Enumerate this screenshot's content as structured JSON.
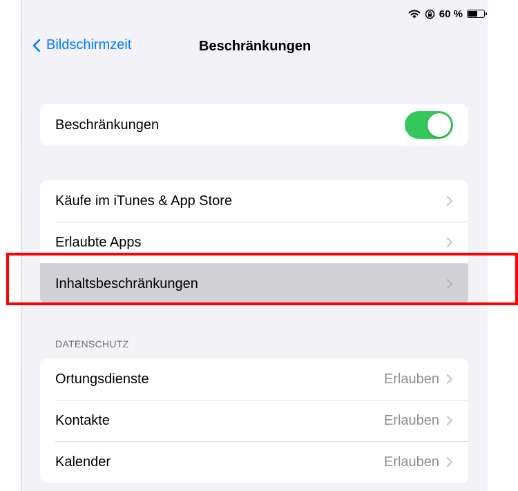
{
  "status_bar": {
    "battery_text": "60 %",
    "battery_level": 0.6,
    "icons": [
      "wifi-icon",
      "orientation-lock-icon",
      "battery-icon"
    ]
  },
  "nav": {
    "back_label": "Bildschirmzeit",
    "title": "Beschränkungen"
  },
  "toggle_group": {
    "label": "Beschränkungen",
    "toggle_on": true,
    "toggle_color": "#34c759"
  },
  "settings": [
    {
      "label": "Käufe im iTunes & App Store"
    },
    {
      "label": "Erlaubte Apps"
    },
    {
      "label": "Inhaltsbeschränkungen",
      "highlighted": true
    }
  ],
  "privacy": {
    "header": "DATENSCHUTZ",
    "items": [
      {
        "label": "Ortungsdienste",
        "value": "Erlauben"
      },
      {
        "label": "Kontakte",
        "value": "Erlauben"
      },
      {
        "label": "Kalender",
        "value": "Erlauben"
      }
    ]
  },
  "colors": {
    "accent": "#007aff",
    "highlight_box": "#ff0000",
    "background": "#f2f2f7"
  }
}
